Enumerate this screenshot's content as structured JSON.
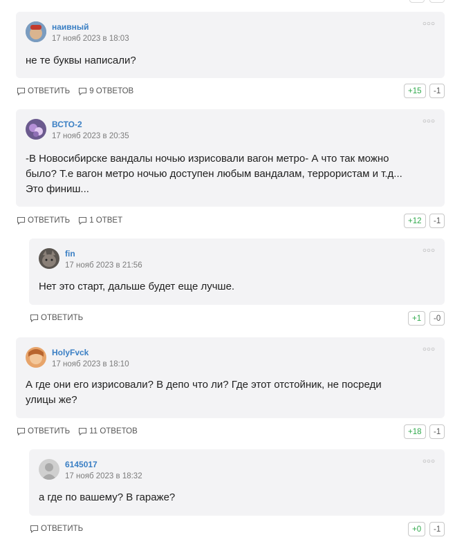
{
  "comments": [
    {
      "author": "наивный",
      "date": "17 нояб 2023 в 18:03",
      "text": [
        "не те буквы написали?"
      ],
      "reply_label": "ОТВЕТИТЬ",
      "replies_label": "9 ОТВЕТОВ",
      "plus": "+15",
      "minus": "-1"
    },
    {
      "author": "ВСТО-2",
      "date": "17 нояб 2023 в 20:35",
      "text": [
        "-В Новосибирске вандалы ночью изрисовали вагон метро- А что так можно",
        "было? Т.е вагон метро ночью доступен любым вандалам, террористам и т.д...",
        "Это финиш..."
      ],
      "reply_label": "ОТВЕТИТЬ",
      "replies_label": "1 ОТВЕТ",
      "plus": "+12",
      "minus": "-1"
    },
    {
      "author": "fin",
      "date": "17 нояб 2023 в 21:56",
      "text": [
        "Нет это старт, дальше будет еще лучше."
      ],
      "reply_label": "ОТВЕТИТЬ",
      "plus": "+1",
      "minus": "-0"
    },
    {
      "author": "HolyFvck",
      "date": "17 нояб 2023 в 18:10",
      "text": [
        "А где они его изрисовали? В депо что ли? Где этот отстойник, не посреди",
        "улицы же?"
      ],
      "reply_label": "ОТВЕТИТЬ",
      "replies_label": "11 ОТВЕТОВ",
      "plus": "+18",
      "minus": "-1"
    },
    {
      "author": "6145017",
      "date": "17 нояб 2023 в 18:32",
      "text": [
        "а где по вашему? В гараже?"
      ],
      "reply_label": "ОТВЕТИТЬ",
      "plus": "+0",
      "minus": "-1"
    }
  ],
  "menu_icon": "more-dots-icon",
  "reply_icon": "speech-bubble-icon",
  "replies_icon": "speech-bubble-icon",
  "colors": {
    "author": "#3a7fc4",
    "plus": "#2ea84a",
    "card": "#f3f3f5"
  }
}
